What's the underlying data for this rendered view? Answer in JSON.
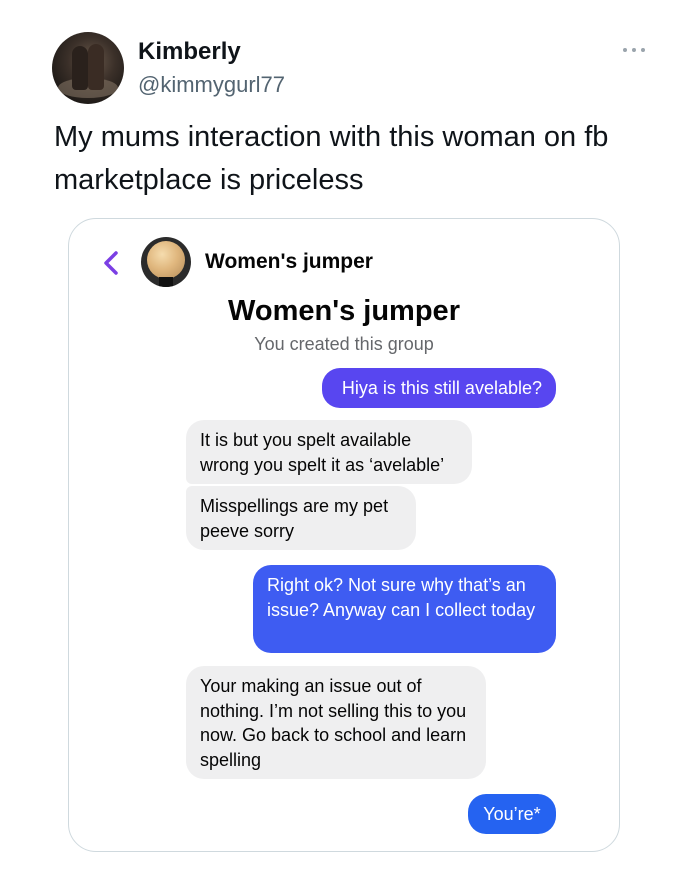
{
  "tweet": {
    "display_name": "Kimberly",
    "handle": "@kimmygurl77",
    "text": "My mums interaction with this woman on fb marketplace is priceless",
    "more_icon": "ellipsis-icon"
  },
  "screenshot": {
    "header_title": "Women's jumper",
    "back_icon": "chevron-left-icon",
    "group_title": "Women's jumper",
    "group_subtitle": "You created this group",
    "accent_color": "#7b3fe4",
    "messages": [
      {
        "from": "me",
        "text": "Hiya is this still avelable?"
      },
      {
        "from": "them",
        "text": "It is but you spelt available wrong you spelt it as ‘avelable’"
      },
      {
        "from": "them",
        "text": "Misspellings are my pet peeve sorry"
      },
      {
        "from": "me",
        "text": "Right ok? Not sure why that’s an issue? Anyway can I collect today"
      },
      {
        "from": "them",
        "text": "Your making an issue out of nothing. I’m not selling this to you now. Go back to school and learn spelling"
      },
      {
        "from": "me",
        "text": "You’re*"
      }
    ]
  }
}
